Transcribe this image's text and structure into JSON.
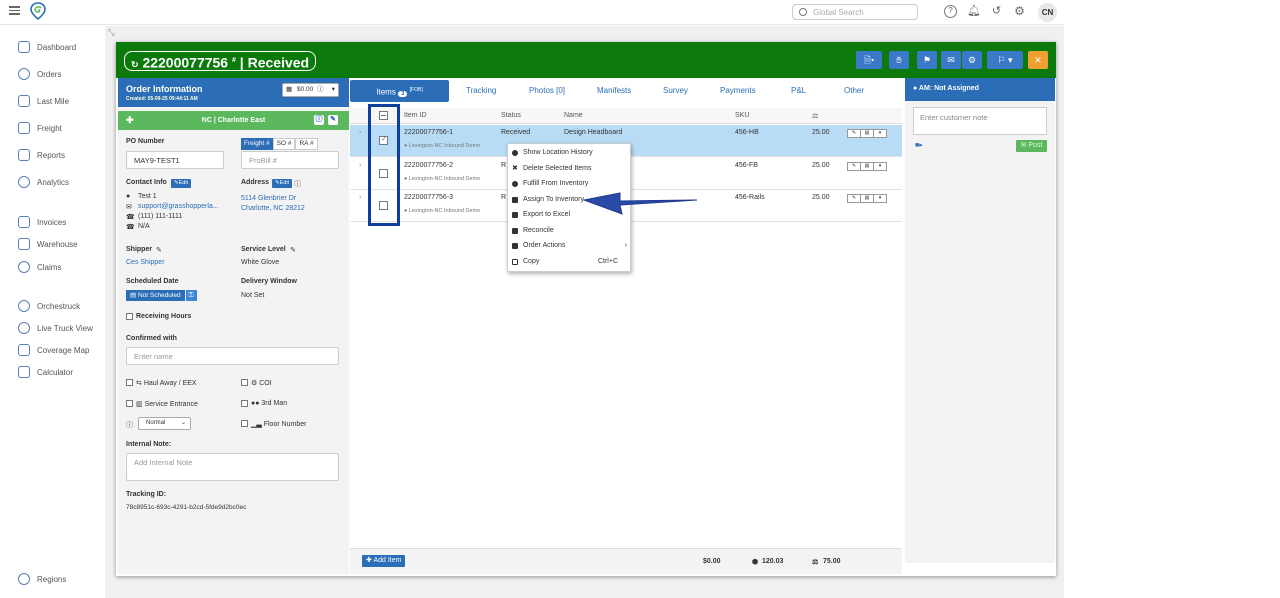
{
  "topbar": {
    "search_placeholder": "Global Search",
    "avatar_initials": "CN"
  },
  "sidebar": {
    "items": [
      {
        "label": "Dashboard"
      },
      {
        "label": "Orders"
      },
      {
        "label": "Last Mile"
      },
      {
        "label": "Freight"
      },
      {
        "label": "Reports"
      },
      {
        "label": "Analytics"
      },
      {
        "label": "Invoices"
      },
      {
        "label": "Warehouse"
      },
      {
        "label": "Claims"
      },
      {
        "label": "Orchestruck"
      },
      {
        "label": "Live Truck View"
      },
      {
        "label": "Coverage Map"
      },
      {
        "label": "Calculator"
      },
      {
        "label": "Regions"
      }
    ]
  },
  "header": {
    "order_number": "22200077756",
    "order_suffix": "#",
    "status": "Received",
    "color": "#0b7a0b"
  },
  "order_info": {
    "title": "Order Information",
    "created": "Created: 05-09-25 09:44:11 AM",
    "price": "$0.00",
    "region": "NC | Charlotte East",
    "po_label": "PO Number",
    "po_value": "MAY9-TEST1",
    "ref_tabs": [
      "Freight #",
      "SO #",
      "RA #"
    ],
    "probill_placeholder": "ProBill #",
    "contact_label": "Contact Info",
    "edit_label": "Edit",
    "contact_name": "Test 1",
    "contact_email": "support@grasshopperla...",
    "contact_phone": "(111) 111-1111",
    "contact_alt": "N/A",
    "address_label": "Address",
    "address_line1": "5114 Glenbrier Dr",
    "address_line2": "Charlotte, NC 28212",
    "shipper_label": "Shipper",
    "shipper_value": "Ces Shipper",
    "service_label": "Service Level",
    "service_value": "White Glove",
    "scheduled_label": "Scheduled Date",
    "scheduled_value": "Not Scheduled",
    "window_label": "Delivery Window",
    "window_value": "Not Set",
    "receiving_hours": "Receiving Hours",
    "confirmed_label": "Confirmed with",
    "confirmed_placeholder": "Enter name",
    "opt_haul": "Haul Away / EEX",
    "opt_coi": "COI",
    "opt_service_entrance": "Service Entrance",
    "opt_3rd_man": "3rd Man",
    "priority_value": "Normal",
    "opt_floor": "Floor Number",
    "internal_note_label": "Internal Note:",
    "internal_note_placeholder": "Add Internal Note",
    "tracking_label": "Tracking ID:",
    "tracking_value": "78c8951c-693c-4291-b2cd-5fde9d2bc0ec"
  },
  "tabs": {
    "items_label": "Items",
    "items_count": "3",
    "items_suffix": "[FOB]",
    "tracking": "Tracking",
    "photos": "Photos [0]",
    "manifests": "Manifests",
    "survey": "Survey",
    "payments": "Payments",
    "pl": "P&L",
    "other": "Other"
  },
  "grid": {
    "headers": {
      "item_id": "Item ID",
      "status": "Status",
      "name": "Name",
      "sku": "SKU"
    },
    "rows": [
      {
        "item_id": "22200077756-1",
        "location": "Lexington-NC Inbound Demo",
        "status": "Received",
        "name": "Design Headboard",
        "sku": "456-HB",
        "weight": "25.00"
      },
      {
        "item_id": "22200077756-2",
        "location": "Lexington-NC Inbound Demo",
        "status": "R",
        "name": "",
        "sku": "456-FB",
        "weight": "25.00"
      },
      {
        "item_id": "22200077756-3",
        "location": "Lexington-NC Inbound Demo",
        "status": "R",
        "name": "",
        "sku": "456-Rails",
        "weight": "25.00"
      }
    ]
  },
  "footer": {
    "add_item": "Add Item",
    "total_price": "$0.00",
    "total_cube": "120.03",
    "total_weight": "75.00"
  },
  "context_menu": {
    "items": [
      "Show Location History",
      "Delete Selected Items",
      "Fulfill From Inventory",
      "Assign To Inventory",
      "Export to Excel",
      "Reconcile",
      "Order Actions",
      "Copy"
    ],
    "copy_shortcut": "Ctrl+C"
  },
  "right": {
    "am_label": "AM: Not Assigned",
    "note_placeholder": "Enter customer note",
    "post_label": "Post"
  },
  "colors": {
    "accent": "#2b6db7",
    "green": "#0b7a0b",
    "success": "#5cb85c",
    "highlight": "#0e3f9e",
    "orange": "#f0a030"
  }
}
